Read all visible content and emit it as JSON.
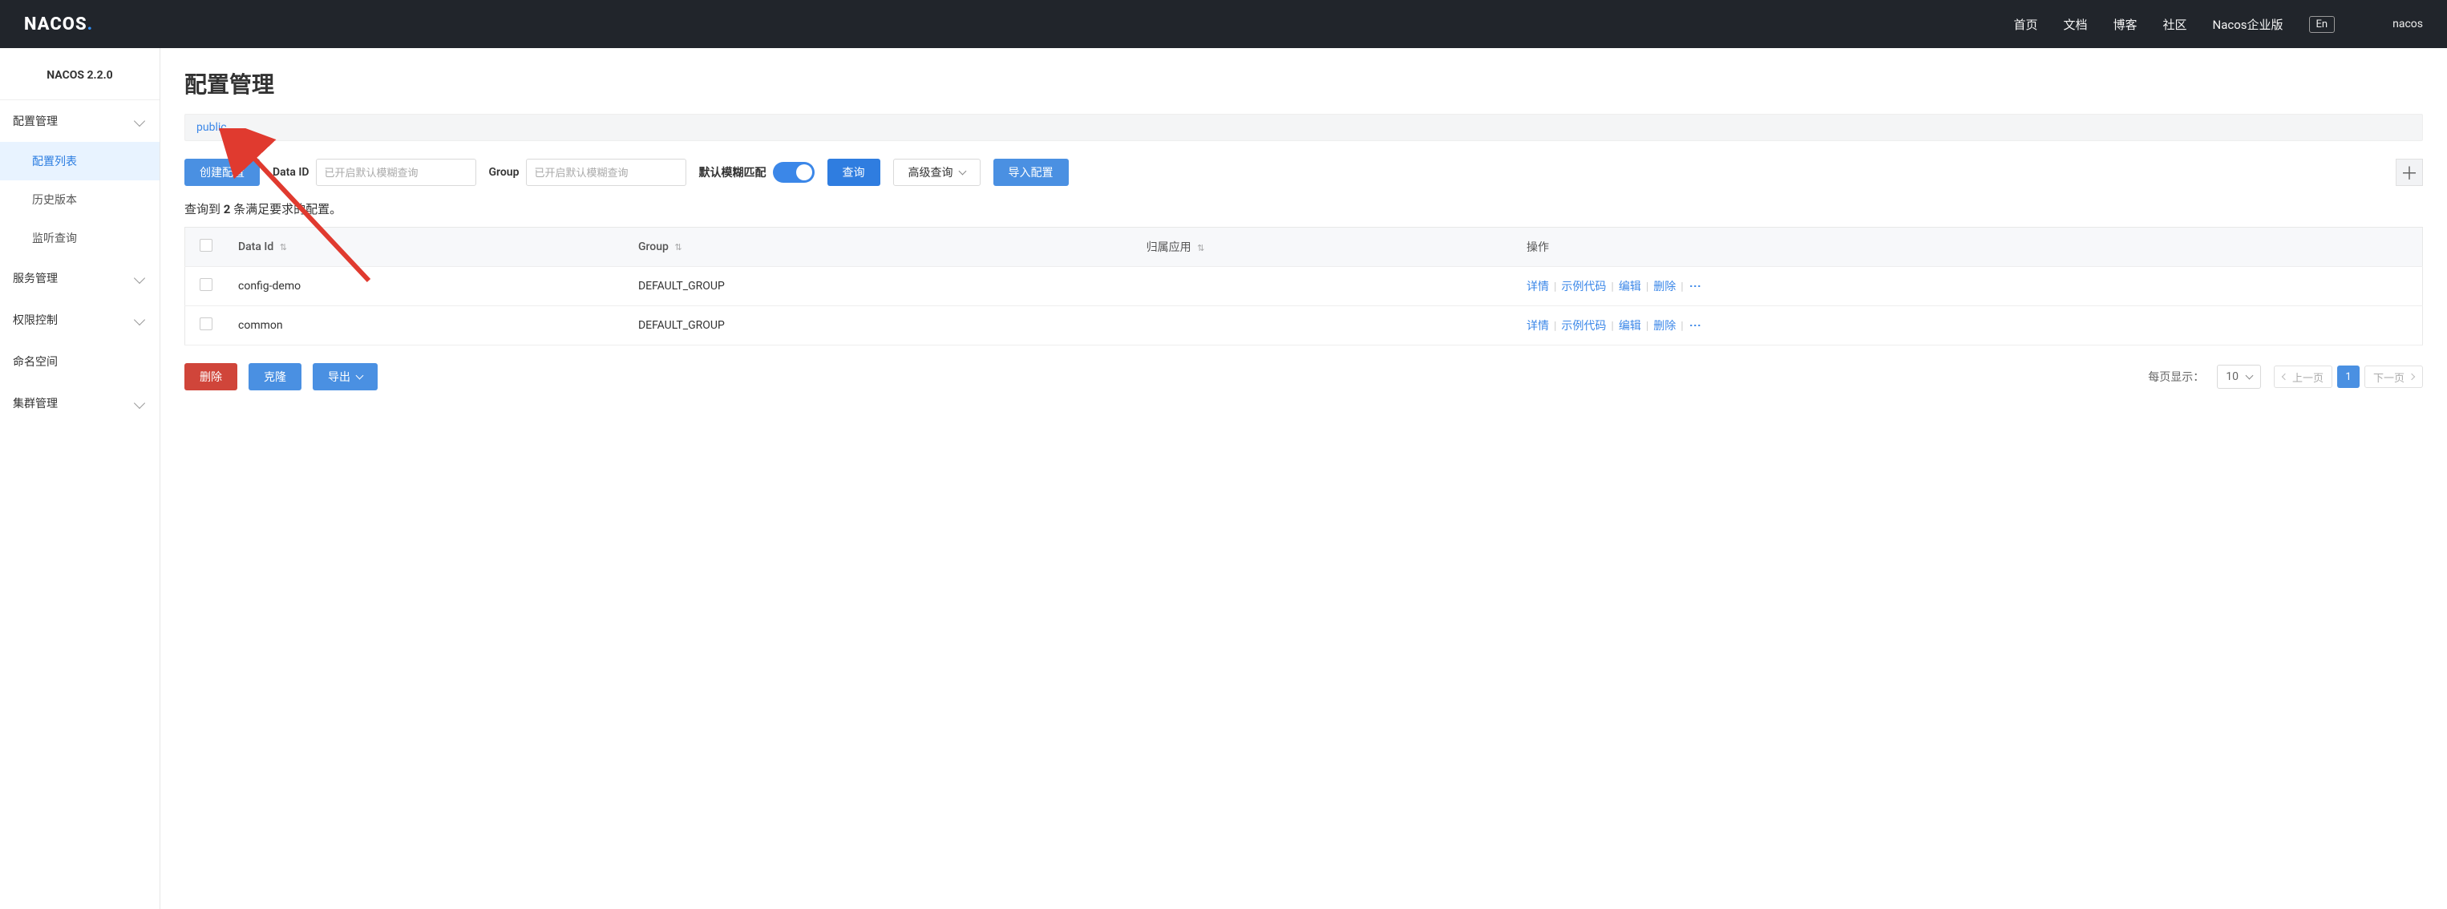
{
  "navbar": {
    "logo_text": "NACOS",
    "links": [
      "首页",
      "文档",
      "博客",
      "社区",
      "Nacos企业版"
    ],
    "lang": "En",
    "user": "nacos"
  },
  "sidebar": {
    "version": "NACOS 2.2.0",
    "groups": [
      {
        "label": "配置管理",
        "expandable": true,
        "expanded": true,
        "items": [
          {
            "label": "配置列表",
            "active": true
          },
          {
            "label": "历史版本",
            "active": false
          },
          {
            "label": "监听查询",
            "active": false
          }
        ]
      },
      {
        "label": "服务管理",
        "expandable": true,
        "expanded": false,
        "items": []
      },
      {
        "label": "权限控制",
        "expandable": true,
        "expanded": false,
        "items": []
      },
      {
        "label": "命名空间",
        "expandable": false,
        "expanded": false,
        "items": []
      },
      {
        "label": "集群管理",
        "expandable": true,
        "expanded": false,
        "items": []
      }
    ]
  },
  "page": {
    "title": "配置管理",
    "namespace": "public"
  },
  "toolbar": {
    "create_label": "创建配置",
    "data_id_label": "Data ID",
    "data_id_placeholder": "已开启默认模糊查询",
    "group_label": "Group",
    "group_placeholder": "已开启默认模糊查询",
    "fuzzy_label": "默认模糊匹配",
    "fuzzy_on": true,
    "search_label": "查询",
    "advanced_label": "高级查询",
    "import_label": "导入配置"
  },
  "result": {
    "prefix": "查询到 ",
    "count": "2",
    "suffix": " 条满足要求的配置。"
  },
  "table": {
    "columns": {
      "data_id": "Data Id",
      "group": "Group",
      "app": "归属应用",
      "ops": "操作"
    },
    "rows": [
      {
        "data_id": "config-demo",
        "group": "DEFAULT_GROUP",
        "app": ""
      },
      {
        "data_id": "common",
        "group": "DEFAULT_GROUP",
        "app": ""
      }
    ],
    "ops": {
      "detail": "详情",
      "example": "示例代码",
      "edit": "编辑",
      "delete": "删除"
    }
  },
  "batch": {
    "delete": "删除",
    "clone": "克隆",
    "export": "导出"
  },
  "pager": {
    "per_page_label": "每页显示：",
    "per_page_value": "10",
    "prev": "上一页",
    "next": "下一页",
    "current": "1"
  }
}
